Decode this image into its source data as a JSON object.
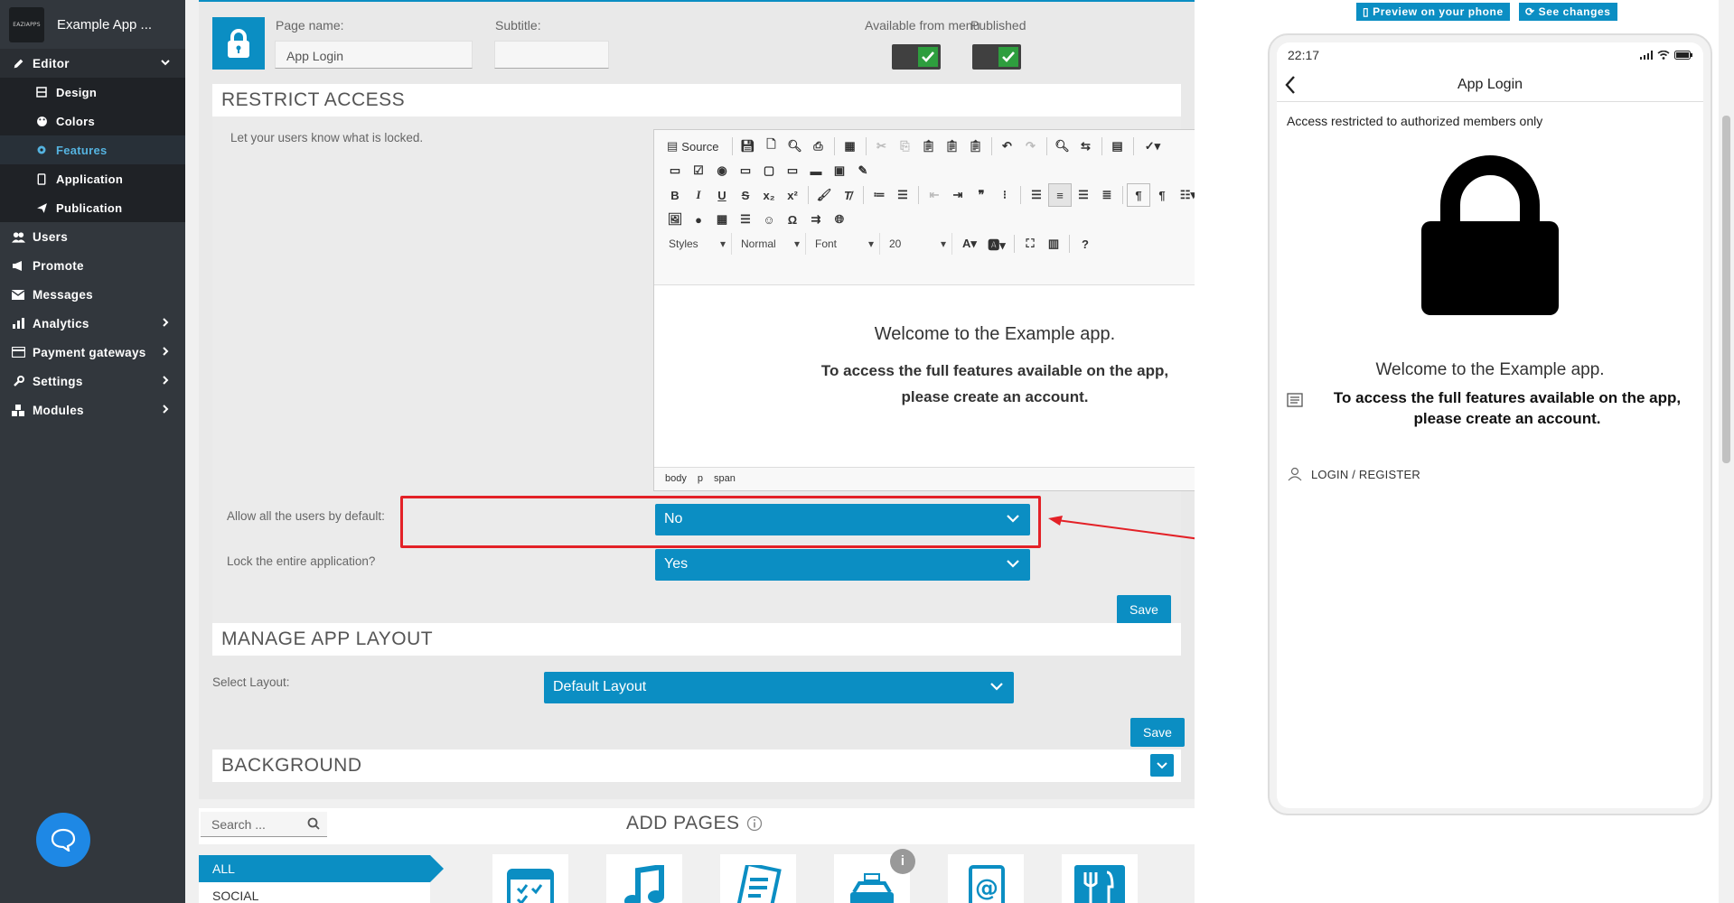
{
  "sidebar": {
    "app_name": "Example App ...",
    "logo_text": "EAZIAPPS",
    "editor_label": "Editor",
    "editor_items": [
      {
        "label": "Design"
      },
      {
        "label": "Colors"
      },
      {
        "label": "Features"
      },
      {
        "label": "Application"
      },
      {
        "label": "Publication"
      }
    ],
    "items": [
      {
        "label": "Users"
      },
      {
        "label": "Promote"
      },
      {
        "label": "Messages"
      },
      {
        "label": "Analytics"
      },
      {
        "label": "Payment gateways"
      },
      {
        "label": "Settings"
      },
      {
        "label": "Modules"
      }
    ]
  },
  "page": {
    "name_label": "Page name:",
    "name_value": "App Login",
    "subtitle_label": "Subtitle:",
    "subtitle_value": "",
    "available_label": "Available from menu",
    "published_label": "Published"
  },
  "restrict": {
    "title": "RESTRICT ACCESS",
    "help_label": "Let your users know what is locked.",
    "editor": {
      "source_label": "Source",
      "styles": "Styles",
      "format": "Normal",
      "font": "Font",
      "size": "20",
      "welcome": "Welcome to the Example app.",
      "bold_line1": "To access the full features available on the app,",
      "bold_line2": "please create an account.",
      "path": [
        "body",
        "p",
        "span"
      ]
    },
    "allow_label": "Allow all the users by default:",
    "allow_value": "No",
    "lock_label": "Lock the entire application?",
    "lock_value": "Yes",
    "save_label": "Save"
  },
  "layout": {
    "title": "MANAGE APP LAYOUT",
    "select_label": "Select Layout:",
    "select_value": "Default Layout",
    "save_label": "Save"
  },
  "background": {
    "title": "BACKGROUND"
  },
  "add_pages": {
    "search_placeholder": "Search ...",
    "title": "ADD PAGES",
    "categories": [
      "ALL",
      "SOCIAL"
    ]
  },
  "preview": {
    "preview_btn": "Preview on your phone",
    "changes_btn": "See changes",
    "time": "22:17",
    "app_title": "App Login",
    "restricted_text": "Access restricted to authorized members only",
    "welcome": "Welcome to the Example app.",
    "bold_line1": "To access the full features available on the app,",
    "bold_line2": "please create an account.",
    "login_label": "LOGIN / REGISTER"
  },
  "colors": {
    "accent": "#0b8ec3",
    "sidebar": "#32373d",
    "highlight_red": "#e32127"
  }
}
